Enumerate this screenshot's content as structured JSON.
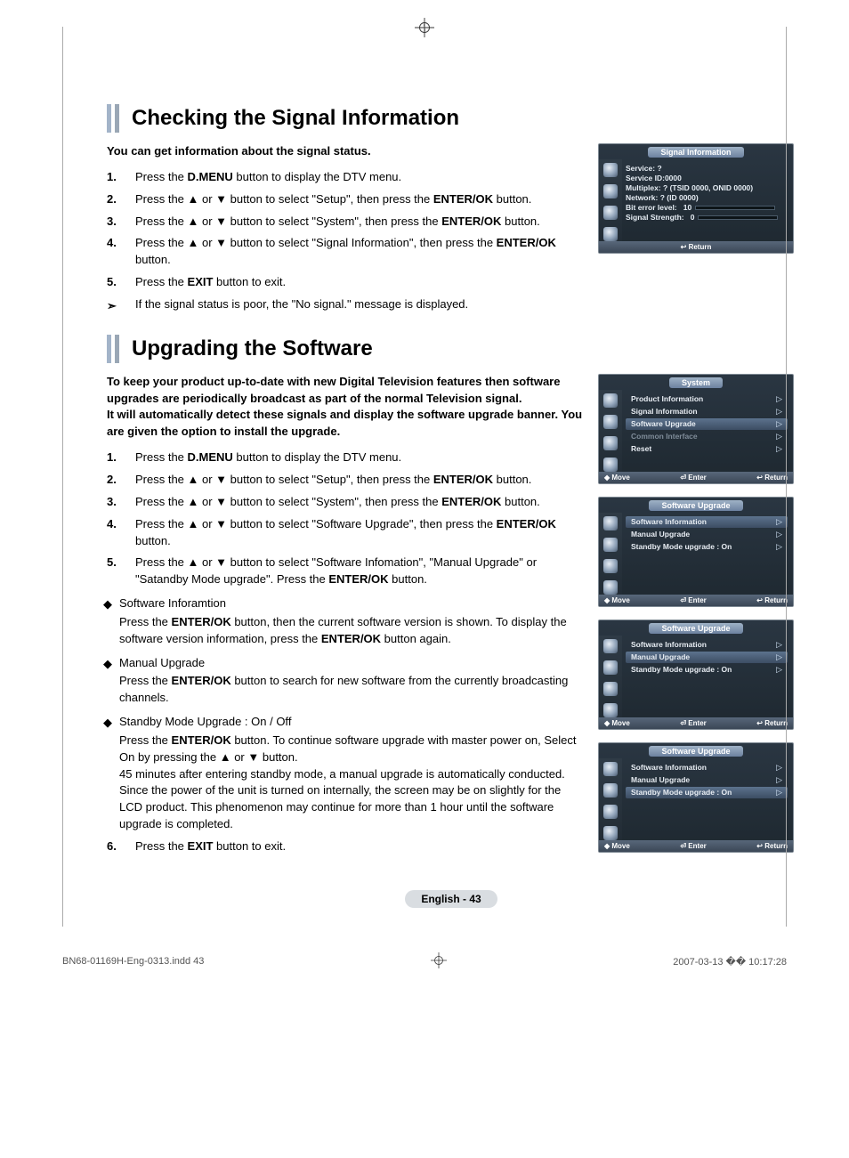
{
  "section1": {
    "title": "Checking the Signal Information",
    "intro": "You can get information about the signal status.",
    "steps": [
      "Press the <b>D.MENU</b> button to display the DTV menu.",
      "Press the ▲ or ▼ button to select \"Setup\", then press the <b>ENTER/OK</b> button.",
      "Press the ▲ or ▼ button to select \"System\", then press the <b>ENTER/OK</b> button.",
      "Press the ▲ or ▼ button to select \"Signal Information\", then press the <b>ENTER/OK</b> button.",
      "Press the <b>EXIT</b> button to exit."
    ],
    "note_symbol": "➣",
    "note": "If the signal status is poor, the \"No signal.\" message is displayed."
  },
  "section2": {
    "title": "Upgrading the Software",
    "intro": "To keep your product up-to-date with new Digital Television features then software upgrades are periodically broadcast as part of the normal Television signal.\nIt will automatically detect these signals and display the software upgrade banner. You are given the option to install the upgrade.",
    "steps_a": [
      "Press the <b>D.MENU</b> button to display the DTV menu.",
      "Press the ▲ or ▼ button to select \"Setup\", then press the <b>ENTER/OK</b> button.",
      "Press the ▲ or ▼ button to select \"System\", then press the <b>ENTER/OK</b> button.",
      "Press the ▲ or ▼ button to select \"Software Upgrade\", then press the <b>ENTER/OK</b> button.",
      "Press the ▲ or ▼ button to select \"Software Infomation\", \"Manual Upgrade\" or \"Satandby Mode upgrade\". Press the <b>ENTER/OK</b> button."
    ],
    "diamond": "◆",
    "sub_si_title": "Software Inforamtion",
    "sub_si_body": "Press the <b>ENTER/OK</b> button, then the current software version is shown. To display the software version information, press the <b>ENTER/OK</b> button again.",
    "sub_mu_title": "Manual Upgrade",
    "sub_mu_body": "Press the <b>ENTER/OK</b> button to search for new software from the currently broadcasting channels.",
    "sub_sb_title": "Standby Mode Upgrade : On / Off",
    "sub_sb_body": "Press the <b>ENTER/OK</b> button. To continue software upgrade with master power on, Select On by pressing the ▲ or ▼ button.\n45 minutes after entering standby mode, a manual upgrade is automatically conducted. Since the power of the unit is turned on internally, the screen may be on slightly for the LCD product. This phenomenon may continue for more than 1 hour until the software upgrade is completed.",
    "step6_num": "6.",
    "step6": "Press the <b>EXIT</b> button to exit."
  },
  "osd_signal": {
    "title": "Signal Information",
    "service": "Service: ?",
    "service_id": "Service ID:0000",
    "multiplex": "Multiplex: ? (TSID 0000, ONID 0000)",
    "network": "Network: ? (ID 0000)",
    "bit_error_label": "Bit error level:",
    "bit_error_val": "10",
    "strength_label": "Signal Strength:",
    "strength_val": "0",
    "return": "↩ Return"
  },
  "osd_system": {
    "title": "System",
    "items": [
      {
        "label": "Product Information",
        "sel": false,
        "dis": false
      },
      {
        "label": "Signal Information",
        "sel": false,
        "dis": false
      },
      {
        "label": "Software Upgrade",
        "sel": true,
        "dis": false
      },
      {
        "label": "Common Interface",
        "sel": false,
        "dis": true
      },
      {
        "label": "Reset",
        "sel": false,
        "dis": false
      }
    ]
  },
  "osd_su": {
    "title": "Software Upgrade",
    "items": [
      {
        "label": "Software Information"
      },
      {
        "label": "Manual Upgrade"
      },
      {
        "label": "Standby Mode upgrade : On"
      }
    ]
  },
  "help": {
    "move": "◆ Move",
    "enter": "⏎ Enter",
    "return": "↩ Return"
  },
  "page_label": "English - 43",
  "footer": {
    "left": "BN68-01169H-Eng-0313.indd   43",
    "right": "2007-03-13   �� 10:17:28"
  }
}
